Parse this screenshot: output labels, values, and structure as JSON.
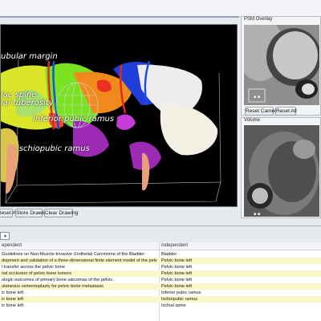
{
  "viewer": {
    "labels": [
      {
        "text": "ubular margin"
      },
      {
        "text": "iac spine"
      },
      {
        "text": "ial tuberosity"
      },
      {
        "text": "inferior pubic ramus"
      },
      {
        "text": "ischiopubic ramus"
      }
    ],
    "toolbar": {
      "reset_all_label": "Reset All",
      "store_drawing_label": "Store Drawing",
      "clear_drawing_label": "Clear Drawing"
    }
  },
  "overlay_panel": {
    "title": "PSM Overlay",
    "reset_camera_label": "Reset Camera",
    "reset_all_label": "Reset All"
  },
  "volume_panel": {
    "title": "Volume"
  },
  "table": {
    "columns": [
      "ependent",
      "independent"
    ],
    "rows": [
      {
        "left": "Guidelines on Non-Muscle-Invasive Urothelial Carcinoma of the Bladder",
        "right": "Bladder"
      },
      {
        "left": "dopment and validation of a three-dimensional finite element model of the pelvic bone",
        "right": "Pelvic bone left"
      },
      {
        "left": "l transfer across the pelvic bone",
        "right": "Pelvic bone left"
      },
      {
        "left": "rial occlusion of pelvic bone tumors",
        "right": "Pelvic bone left"
      },
      {
        "left": "ologic outcomes of primary bone sarcomas of the pelvis",
        "right": "Pelvic bone left"
      },
      {
        "left": "utaneous cementoplasty for pelvic bone metastasis",
        "right": "Pelvic bone left"
      },
      {
        "left": "ic bone left",
        "right": "Inferior pubic ramus"
      },
      {
        "left": "ic bone left",
        "right": "Ischiopubic ramus"
      },
      {
        "left": "ic bone left",
        "right": "Ischial spine"
      }
    ]
  }
}
